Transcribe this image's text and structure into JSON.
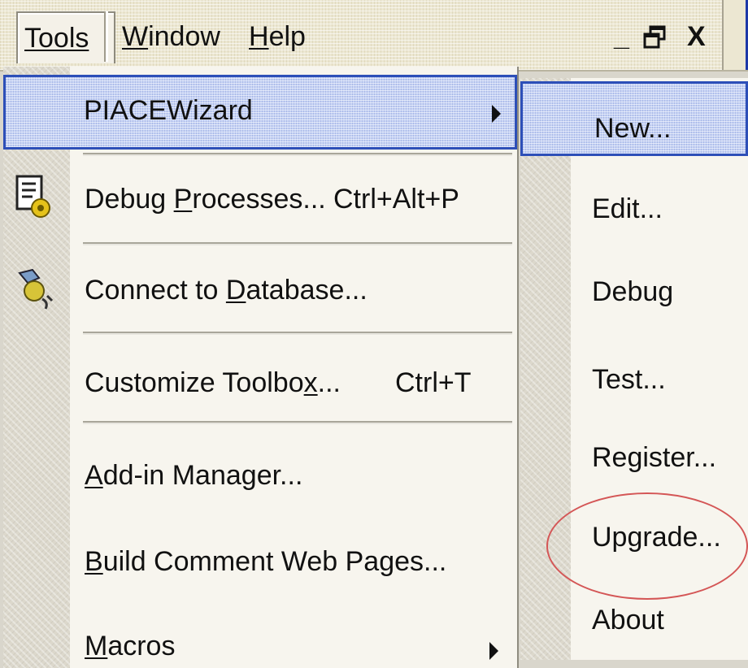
{
  "menubar": {
    "items": [
      {
        "label": "Tools",
        "accesskey_index": 0
      },
      {
        "label": "Window",
        "accesskey_index": 0
      },
      {
        "label": "Help",
        "accesskey_index": 0
      }
    ],
    "window_controls": {
      "minimize": "_",
      "restore": "🗗",
      "close": "X"
    }
  },
  "tools_menu": {
    "items": [
      {
        "label": "PIACEWizard",
        "has_submenu": true,
        "icon": null,
        "shortcut": ""
      },
      {
        "label_pre": "Debug ",
        "label_acc": "P",
        "label_post": "rocesses...",
        "shortcut": "Ctrl+Alt+P",
        "icon": "debug-processes-icon"
      },
      {
        "label_pre": "Connect to ",
        "label_acc": "D",
        "label_post": "atabase...",
        "shortcut": "",
        "icon": "connect-database-icon"
      },
      {
        "label_pre": "Customize Toolbo",
        "label_acc": "x",
        "label_post": "...",
        "shortcut": "Ctrl+T",
        "icon": null
      },
      {
        "label_pre": "",
        "label_acc": "A",
        "label_post": "dd-in Manager...",
        "shortcut": "",
        "icon": null
      },
      {
        "label_pre": "",
        "label_acc": "B",
        "label_post": "uild Comment Web Pages...",
        "shortcut": "",
        "icon": null
      },
      {
        "label_pre": "",
        "label_acc": "M",
        "label_post": "acros",
        "shortcut": "",
        "has_submenu": true,
        "icon": null
      }
    ]
  },
  "submenu": {
    "items": [
      {
        "label": "New..."
      },
      {
        "label": "Edit..."
      },
      {
        "label": "Debug"
      },
      {
        "label": "Test..."
      },
      {
        "label": "Register..."
      },
      {
        "label": "Upgrade..."
      },
      {
        "label": "About"
      }
    ]
  },
  "annotation": {
    "color": "#d45656"
  },
  "colors": {
    "highlight": "#c4d1f3",
    "highlight_border": "#2d4fb8",
    "menu_bg": "#f7f5ee"
  }
}
